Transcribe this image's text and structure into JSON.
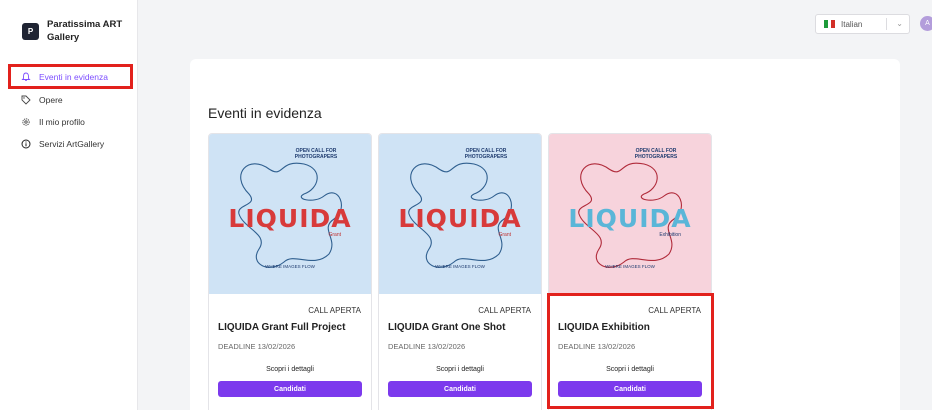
{
  "brand": {
    "logo_letter": "P",
    "name": "Paratissima ART Gallery"
  },
  "sidebar": {
    "items": [
      {
        "label": "Eventi in evidenza",
        "icon": "bell-icon",
        "active": true
      },
      {
        "label": "Opere",
        "icon": "tag-icon",
        "active": false
      },
      {
        "label": "Il mio profilo",
        "icon": "gear-icon",
        "active": false
      },
      {
        "label": "Servizi ArtGallery",
        "icon": "info-icon",
        "active": false
      }
    ]
  },
  "header": {
    "language": {
      "flag": "italy-flag-icon",
      "value": "Italian"
    },
    "avatar_letter": "A"
  },
  "main": {
    "title": "Eventi in evidenza",
    "cards": [
      {
        "status": "CALL APERTA",
        "title": "LIQUIDA Grant Full Project",
        "deadline": "DEADLINE 13/02/2026",
        "details_label": "Scopri i dettagli",
        "apply_label": "Candidati",
        "poster": {
          "open_call": "OPEN CALL FOR PHOTOGRAPERS",
          "word": "LIQUIDA",
          "sub": "Grant",
          "footer": "WHERE IMAGES FLOW",
          "theme": "blue"
        }
      },
      {
        "status": "CALL APERTA",
        "title": "LIQUIDA Grant One Shot",
        "deadline": "DEADLINE 13/02/2026",
        "details_label": "Scopri i dettagli",
        "apply_label": "Candidati",
        "poster": {
          "open_call": "OPEN CALL FOR PHOTOGRAPERS",
          "word": "LIQUIDA",
          "sub": "Grant",
          "footer": "WHERE IMAGES FLOW",
          "theme": "blue"
        }
      },
      {
        "status": "CALL APERTA",
        "title": "LIQUIDA Exhibition",
        "deadline": "DEADLINE 13/02/2026",
        "details_label": "Scopri i dettagli",
        "apply_label": "Candidati",
        "poster": {
          "open_call": "OPEN CALL FOR PHOTOGRAPERS",
          "word": "LIQUIDA",
          "sub": "Exhibition",
          "footer": "WHERE IMAGES FLOW",
          "theme": "pink"
        }
      }
    ]
  },
  "colors": {
    "accent": "#7c3aed",
    "highlight": "#e2211c",
    "active_nav": "#7c4dff"
  }
}
